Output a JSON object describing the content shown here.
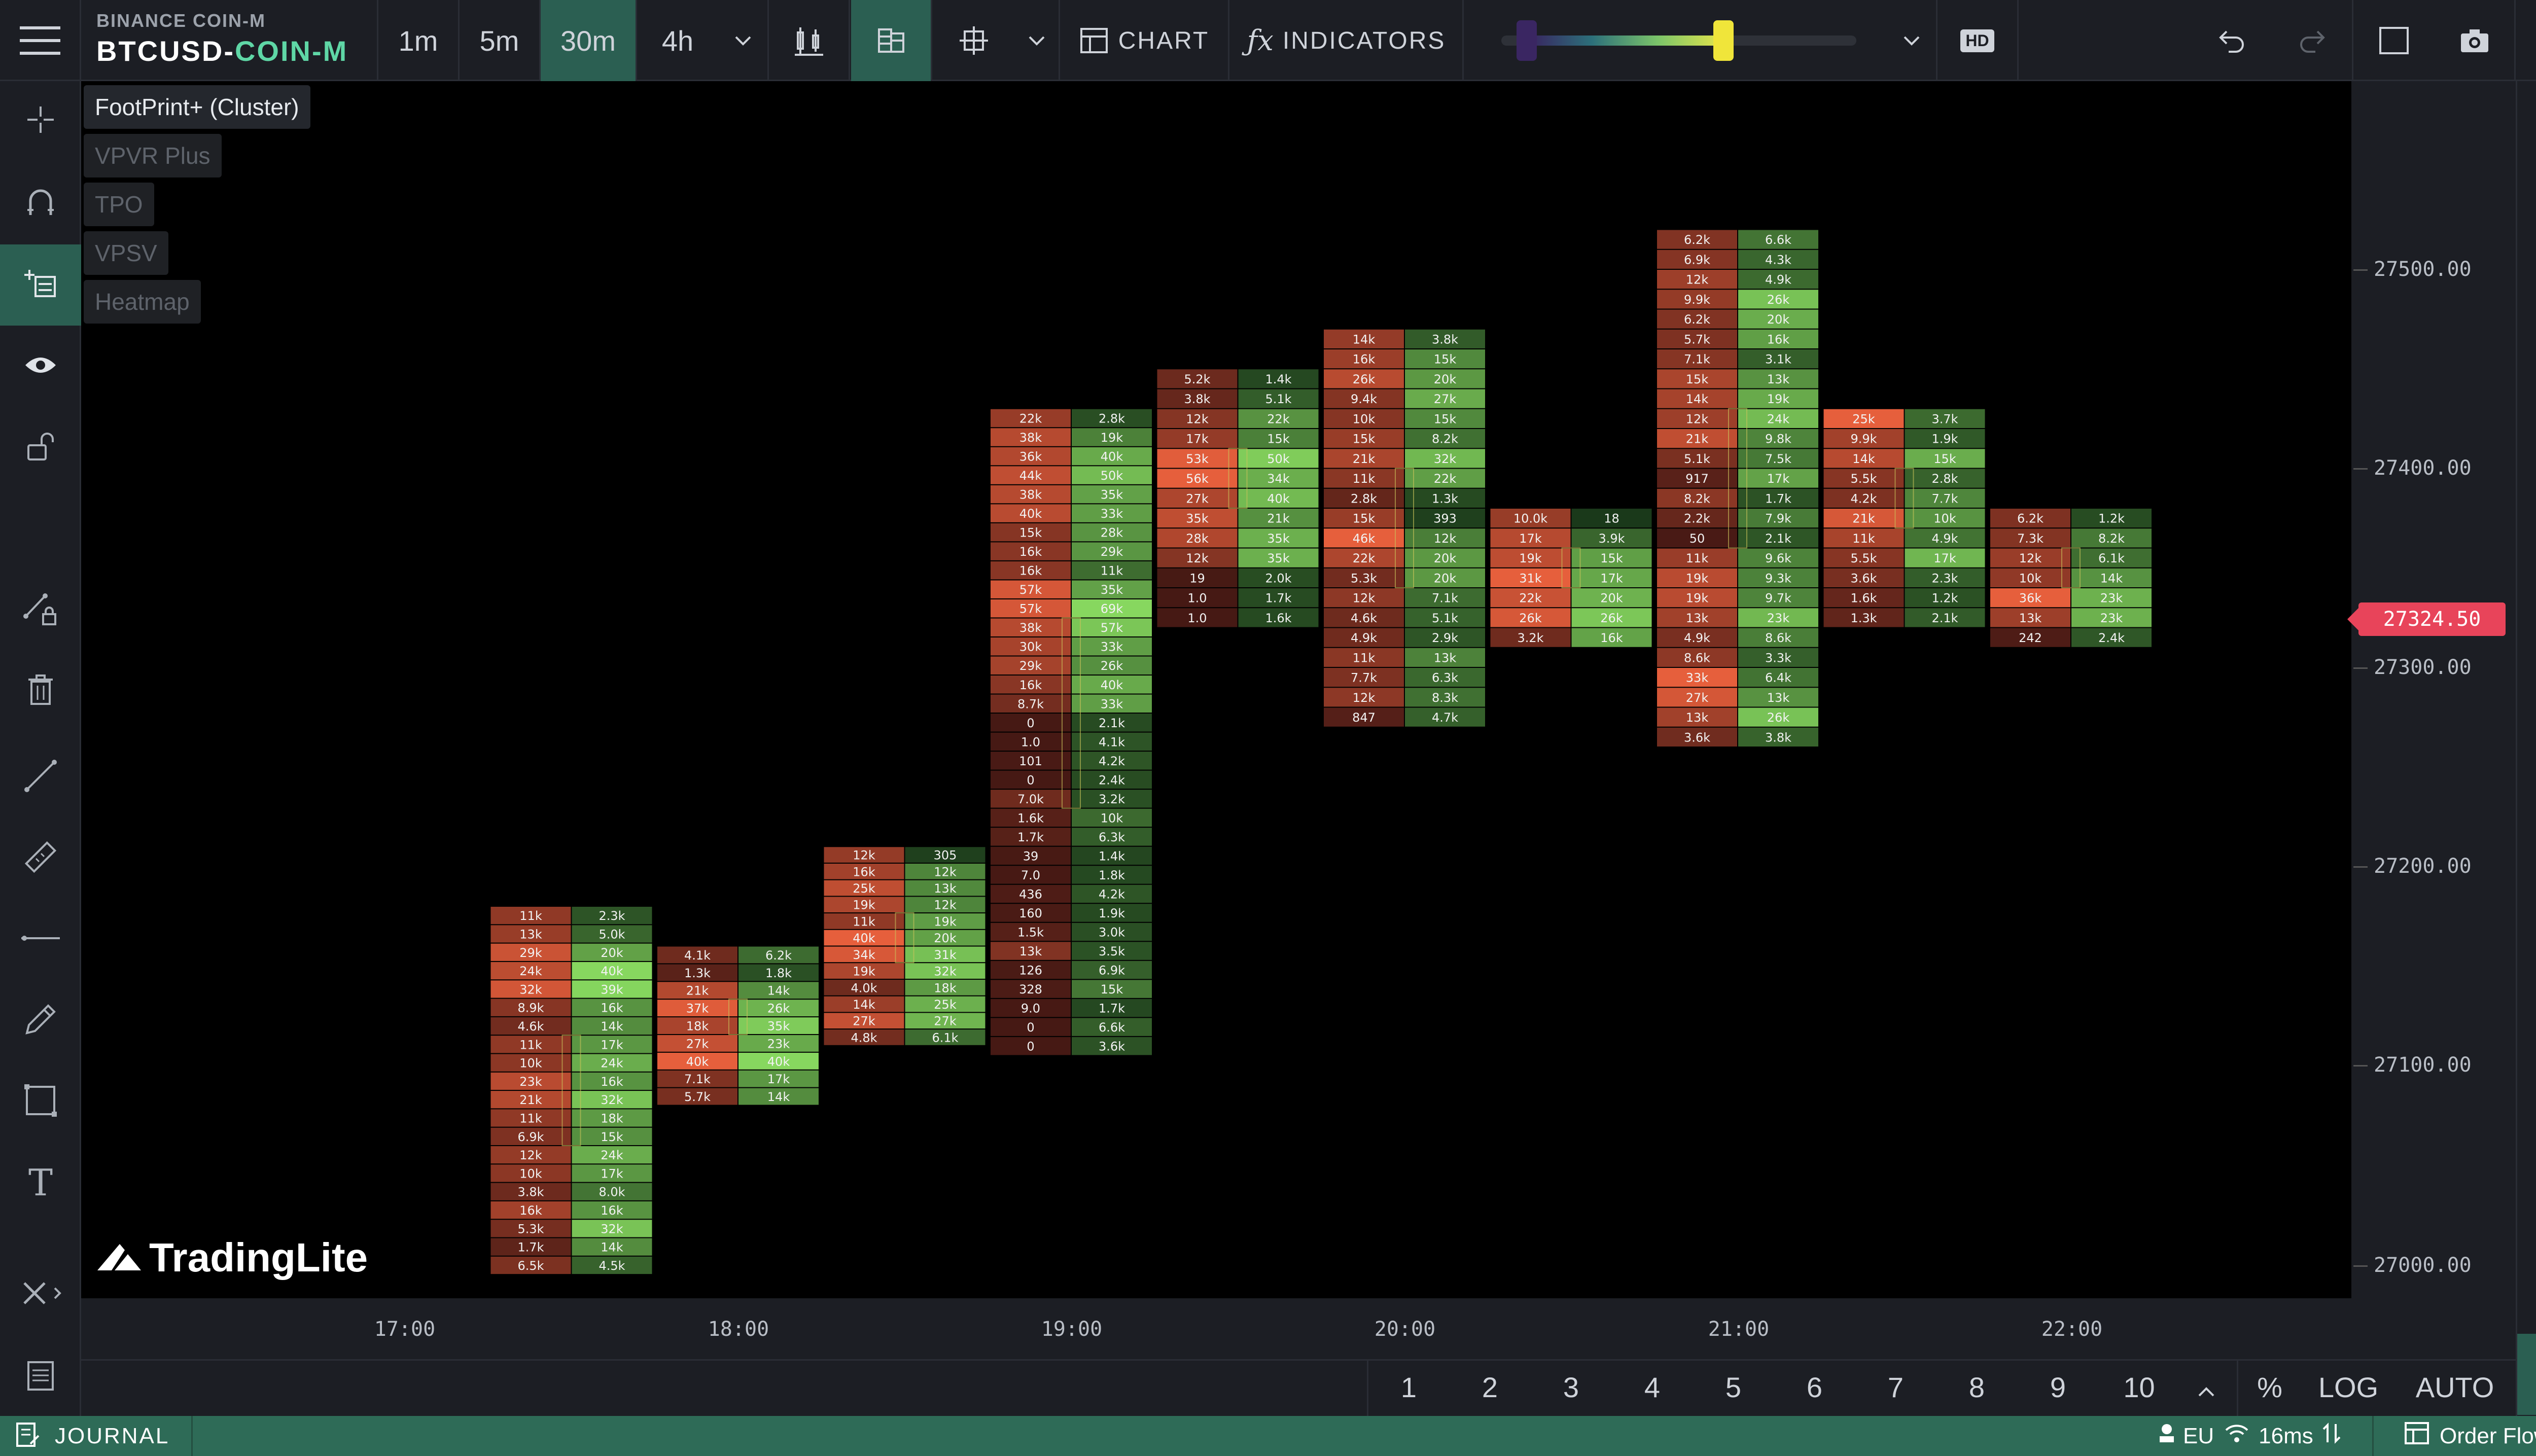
{
  "header": {
    "exchange": "BINANCE COIN-M",
    "symbol_base": "BTCUSD",
    "symbol_sep": "-",
    "symbol_market": "COIN-M",
    "timeframes": [
      "1m",
      "5m",
      "30m",
      "4h"
    ],
    "active_timeframe": "30m",
    "chart_label": "CHART",
    "indicators_label": "INDICATORS",
    "hd_label": "HD"
  },
  "overlays": [
    {
      "label": "FootPrint+ (Cluster)",
      "active": true
    },
    {
      "label": "VPVR Plus",
      "active": false
    },
    {
      "label": "TPO",
      "active": false
    },
    {
      "label": "VPSV",
      "active": false
    },
    {
      "label": "Heatmap",
      "active": false
    }
  ],
  "price_axis": [
    "27500.00",
    "27400.00",
    "27300.00",
    "27200.00",
    "27100.00",
    "27000.00"
  ],
  "current_price": "27324.50",
  "time_axis": [
    "17:00",
    "18:00",
    "19:00",
    "20:00",
    "21:00",
    "22:00"
  ],
  "bottom_bar": {
    "pages": [
      "1",
      "2",
      "3",
      "4",
      "5",
      "6",
      "7",
      "8",
      "9",
      "10"
    ],
    "percent": "%",
    "log": "LOG",
    "auto": "AUTO"
  },
  "status": {
    "journal": "JOURNAL",
    "region": "EU",
    "latency": "16ms",
    "order_flow": "Order Flow"
  },
  "logo_text": "TradingLite",
  "colors": {
    "accent": "#2b5f52",
    "symbol_green": "#5fd7a6",
    "price_badge": "#e8445a",
    "bid": "#e45a3c",
    "ask": "#7cc65a"
  },
  "chart_data": {
    "type": "footprint",
    "rows": [
      {
        "time": "17:30",
        "low": 26995,
        "high": 27180,
        "bid": [
          "11k",
          "13k",
          "29k",
          "24k",
          "32k",
          "8.9k",
          "4.6k",
          "11k",
          "10k",
          "23k",
          "21k",
          "11k",
          "6.9k",
          "12k",
          "10k",
          "3.8k",
          "16k",
          "5.3k",
          "1.7k",
          "6.5k"
        ],
        "ask": [
          "2.3k",
          "5.0k",
          "20k",
          "40k",
          "39k",
          "16k",
          "14k",
          "17k",
          "24k",
          "16k",
          "32k",
          "18k",
          "15k",
          "24k",
          "17k",
          "8.0k",
          "16k",
          "32k",
          "14k",
          "4.5k"
        ]
      },
      {
        "time": "18:00",
        "low": 27080,
        "high": 27160,
        "bid": [
          "4.1k",
          "1.3k",
          "21k",
          "37k",
          "18k",
          "27k",
          "40k",
          "7.1k",
          "5.7k"
        ],
        "ask": [
          "6.2k",
          "1.8k",
          "14k",
          "26k",
          "35k",
          "23k",
          "40k",
          "17k",
          "14k"
        ]
      },
      {
        "time": "18:30",
        "low": 27110,
        "high": 27210,
        "bid": [
          "12k",
          "16k",
          "25k",
          "19k",
          "11k",
          "40k",
          "34k",
          "19k",
          "4.0k",
          "14k",
          "27k",
          "4.8k"
        ],
        "ask": [
          "305",
          "12k",
          "13k",
          "12k",
          "19k",
          "20k",
          "31k",
          "32k",
          "18k",
          "25k",
          "27k",
          "6.1k"
        ]
      },
      {
        "time": "19:00",
        "low": 27105,
        "high": 27430,
        "bid": [
          "22k",
          "38k",
          "36k",
          "44k",
          "38k",
          "40k",
          "15k",
          "16k",
          "16k",
          "57k",
          "57k",
          "38k",
          "30k",
          "29k",
          "16k",
          "8.7k",
          "0",
          "1.0",
          "101",
          "0",
          "7.0k",
          "1.6k",
          "1.7k",
          "39",
          "7.0",
          "436",
          "160",
          "1.5k",
          "13k",
          "126",
          "328",
          "9.0",
          "0",
          "0"
        ],
        "ask": [
          "2.8k",
          "19k",
          "40k",
          "50k",
          "35k",
          "33k",
          "28k",
          "29k",
          "11k",
          "35k",
          "69k",
          "57k",
          "33k",
          "26k",
          "40k",
          "33k",
          "2.1k",
          "4.1k",
          "4.2k",
          "2.4k",
          "3.2k",
          "10k",
          "6.3k",
          "1.4k",
          "1.8k",
          "4.2k",
          "1.9k",
          "3.0k",
          "3.5k",
          "6.9k",
          "15k",
          "1.7k",
          "6.6k",
          "3.6k"
        ]
      },
      {
        "time": "19:30",
        "low": 27320,
        "high": 27450,
        "bid": [
          "5.2k",
          "3.8k",
          "12k",
          "17k",
          "53k",
          "56k",
          "27k",
          "35k",
          "28k",
          "12k",
          "19",
          "1.0",
          "1.0"
        ],
        "ask": [
          "1.4k",
          "5.1k",
          "22k",
          "15k",
          "50k",
          "34k",
          "40k",
          "21k",
          "35k",
          "35k",
          "2.0k",
          "1.7k",
          "1.6k"
        ]
      },
      {
        "time": "20:00",
        "low": 27270,
        "high": 27470,
        "bid": [
          "14k",
          "16k",
          "26k",
          "9.4k",
          "10k",
          "15k",
          "21k",
          "11k",
          "2.8k",
          "15k",
          "46k",
          "22k",
          "5.3k",
          "12k",
          "4.6k",
          "4.9k",
          "11k",
          "7.7k",
          "12k",
          "847"
        ],
        "ask": [
          "3.8k",
          "15k",
          "20k",
          "27k",
          "15k",
          "8.2k",
          "32k",
          "22k",
          "1.3k",
          "393",
          "12k",
          "20k",
          "20k",
          "7.1k",
          "5.1k",
          "2.9k",
          "13k",
          "6.3k",
          "8.3k",
          "4.7k"
        ]
      },
      {
        "time": "20:30",
        "low": 27310,
        "high": 27380,
        "bid": [
          "10.0k",
          "17k",
          "19k",
          "31k",
          "22k",
          "26k",
          "3.2k"
        ],
        "ask": [
          "18",
          "3.9k",
          "15k",
          "17k",
          "20k",
          "26k",
          "16k"
        ]
      },
      {
        "time": "21:00",
        "low": 27260,
        "high": 27520,
        "bid": [
          "6.2k",
          "6.9k",
          "12k",
          "9.9k",
          "6.2k",
          "5.7k",
          "7.1k",
          "15k",
          "14k",
          "12k",
          "21k",
          "5.1k",
          "917",
          "8.2k",
          "2.2k",
          "50",
          "11k",
          "19k",
          "19k",
          "13k",
          "4.9k",
          "8.6k",
          "33k",
          "27k",
          "13k",
          "3.6k"
        ],
        "ask": [
          "6.6k",
          "4.3k",
          "4.9k",
          "26k",
          "20k",
          "16k",
          "3.1k",
          "13k",
          "19k",
          "24k",
          "9.8k",
          "7.5k",
          "17k",
          "1.7k",
          "7.9k",
          "2.1k",
          "9.6k",
          "9.3k",
          "9.7k",
          "23k",
          "8.6k",
          "3.3k",
          "6.4k",
          "13k",
          "26k",
          "3.8k"
        ]
      },
      {
        "time": "21:30",
        "low": 27320,
        "high": 27430,
        "bid": [
          "25k",
          "9.9k",
          "14k",
          "5.5k",
          "4.2k",
          "21k",
          "11k",
          "5.5k",
          "3.6k",
          "1.6k",
          "1.3k"
        ],
        "ask": [
          "3.7k",
          "1.9k",
          "15k",
          "2.8k",
          "7.7k",
          "10k",
          "4.9k",
          "17k",
          "2.3k",
          "1.2k",
          "2.1k"
        ]
      },
      {
        "time": "22:00",
        "low": 27310,
        "high": 27380,
        "bid": [
          "6.2k",
          "7.3k",
          "12k",
          "10k",
          "36k",
          "13k",
          "242"
        ],
        "ask": [
          "1.2k",
          "8.2k",
          "6.1k",
          "14k",
          "23k",
          "23k",
          "2.4k"
        ]
      }
    ]
  }
}
